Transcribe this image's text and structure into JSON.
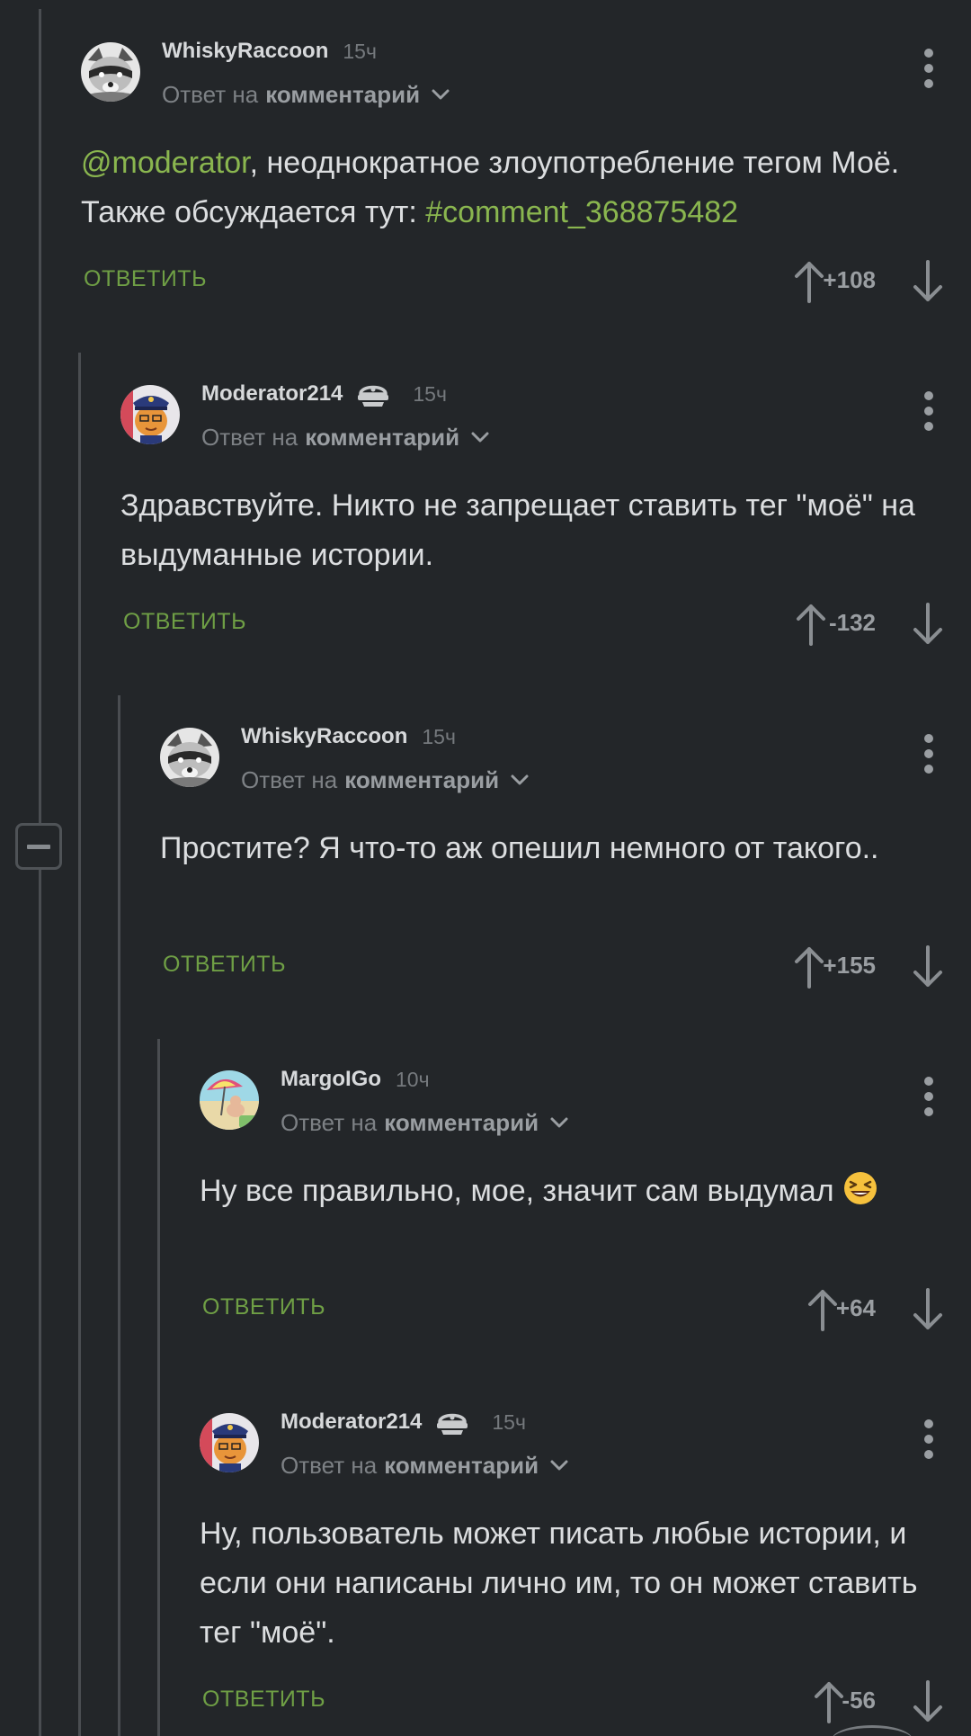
{
  "ui": {
    "reply_prefix": "Ответ на",
    "reply_target": "комментарий",
    "reply_button": "ОТВЕТИТЬ"
  },
  "comments": [
    {
      "author": "WhiskyRaccoon",
      "time": "15ч",
      "is_moderator": false,
      "avatar": "raccoon-avatar",
      "text_parts": [
        {
          "text": "@moderator",
          "link": true
        },
        {
          "text": ", неоднократное злоупотребление тегом Моё. Также обсуждается тут: ",
          "link": false
        },
        {
          "text": "#comment_368875482",
          "link": true
        }
      ],
      "rating": "+108"
    },
    {
      "author": "Moderator214",
      "time": "15ч",
      "is_moderator": true,
      "avatar": "moderator-cat-avatar",
      "text_parts": [
        {
          "text": "Здравствуйте. Никто не запрещает ставить тег \"моё\" на выдуманные истории.",
          "link": false
        }
      ],
      "rating": "-132"
    },
    {
      "author": "WhiskyRaccoon",
      "time": "15ч",
      "is_moderator": false,
      "avatar": "raccoon-avatar",
      "text_parts": [
        {
          "text": "Простите? Я что-то аж опешил немного от такого..",
          "link": false
        }
      ],
      "rating": "+155"
    },
    {
      "author": "MargoIGo",
      "time": "10ч",
      "is_moderator": false,
      "avatar": "beach-avatar",
      "text_parts": [
        {
          "text": "Ну все правильно, мое, значит сам выдумал ",
          "link": false
        }
      ],
      "emoji": "laughing-emoji",
      "rating": "+64"
    },
    {
      "author": "Moderator214",
      "time": "15ч",
      "is_moderator": true,
      "avatar": "moderator-cat-avatar",
      "text_parts": [
        {
          "text": "Ну, пользователь может писать любые истории, и если они написаны лично им, то он может ставить тег \"моё\".",
          "link": false
        }
      ],
      "rating": "-56"
    }
  ]
}
